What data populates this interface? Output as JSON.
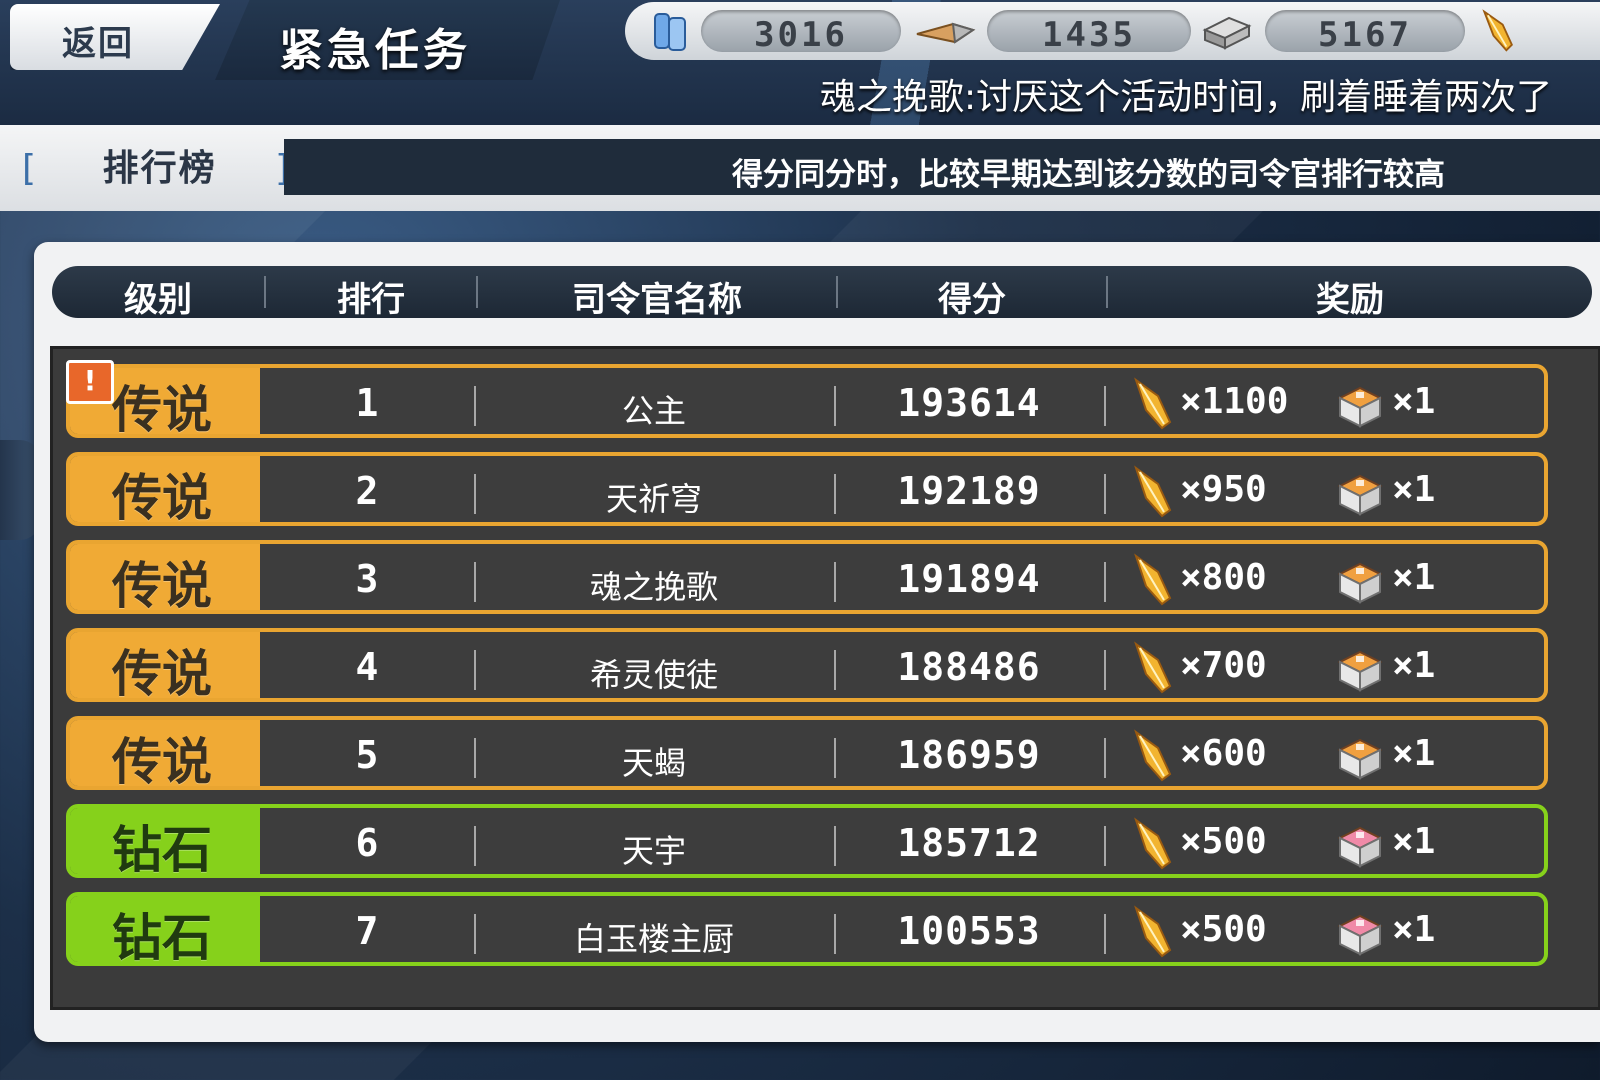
{
  "header": {
    "back_label": "返回",
    "title": "紧急任务",
    "resources": [
      {
        "icon": "fuel-barrel-icon",
        "value": "3016"
      },
      {
        "icon": "ammo-icon",
        "value": "1435"
      },
      {
        "icon": "steel-icon",
        "value": "5167"
      }
    ],
    "marquee": "魂之挽歌:讨厌这个活动时间，刷着睡着两次了"
  },
  "subheader": {
    "tab_label": "排行榜",
    "notice": "得分同分时，比较早期达到该分数的司令官排行较高"
  },
  "columns": [
    "级别",
    "排行",
    "司令官名称",
    "得分",
    "奖励"
  ],
  "rows": [
    {
      "tier": "传说",
      "tier_type": "legend",
      "rank": "1",
      "name": "公主",
      "score": "193614",
      "reward_main": "×1100",
      "reward_box": "×1",
      "box_color": "orange",
      "badge": "!"
    },
    {
      "tier": "传说",
      "tier_type": "legend",
      "rank": "2",
      "name": "天祈穹",
      "score": "192189",
      "reward_main": "×950",
      "reward_box": "×1",
      "box_color": "orange"
    },
    {
      "tier": "传说",
      "tier_type": "legend",
      "rank": "3",
      "name": "魂之挽歌",
      "score": "191894",
      "reward_main": "×800",
      "reward_box": "×1",
      "box_color": "orange"
    },
    {
      "tier": "传说",
      "tier_type": "legend",
      "rank": "4",
      "name": "希灵使徒",
      "score": "188486",
      "reward_main": "×700",
      "reward_box": "×1",
      "box_color": "orange"
    },
    {
      "tier": "传说",
      "tier_type": "legend",
      "rank": "5",
      "name": "天蝎",
      "score": "186959",
      "reward_main": "×600",
      "reward_box": "×1",
      "box_color": "orange"
    },
    {
      "tier": "钻石",
      "tier_type": "diamond",
      "rank": "6",
      "name": "天宇",
      "score": "185712",
      "reward_main": "×500",
      "reward_box": "×1",
      "box_color": "pink"
    },
    {
      "tier": "钻石",
      "tier_type": "diamond",
      "rank": "7",
      "name": "白玉楼主厨",
      "score": "100553",
      "reward_main": "×500",
      "reward_box": "×1",
      "box_color": "pink"
    }
  ],
  "colors": {
    "legend": "#f0aa35",
    "diamond": "#86d11b",
    "box_orange": "#f0a040",
    "box_pink": "#f08aa8"
  }
}
